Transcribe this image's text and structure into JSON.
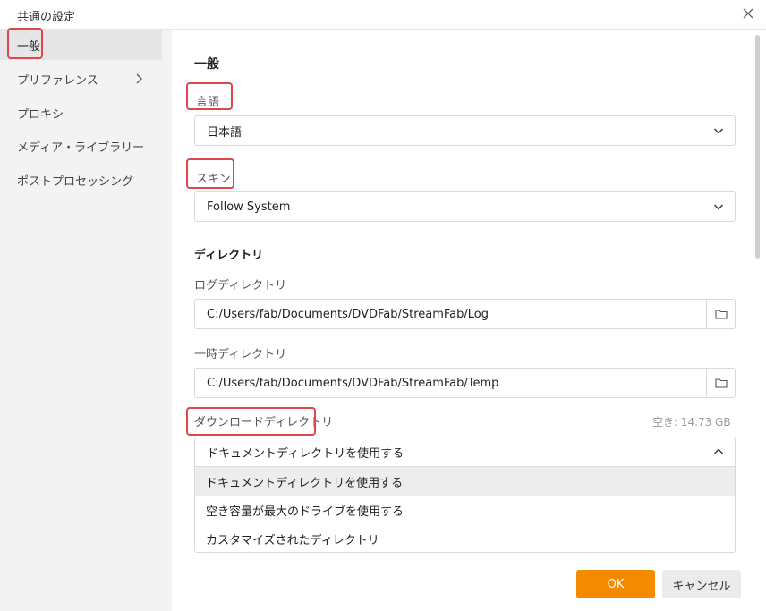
{
  "window": {
    "title": "共通の設定",
    "close_icon": "close-icon"
  },
  "sidebar": {
    "items": [
      {
        "label": "一般",
        "active": true
      },
      {
        "label": "プリファレンス",
        "has_submenu": true
      },
      {
        "label": "プロキシ"
      },
      {
        "label": "メディア・ライブラリー"
      },
      {
        "label": "ポストプロセッシング"
      }
    ]
  },
  "main": {
    "heading": "一般",
    "language": {
      "label": "言語",
      "value": "日本語"
    },
    "skin": {
      "label": "スキン",
      "value": "Follow System"
    },
    "directory": {
      "heading": "ディレクトリ",
      "log": {
        "label": "ログディレクトリ",
        "value": "C:/Users/fab/Documents/DVDFab/StreamFab/Log"
      },
      "temp": {
        "label": "一時ディレクトリ",
        "value": "C:/Users/fab/Documents/DVDFab/StreamFab/Temp"
      },
      "download": {
        "label": "ダウンロードディレクトリ",
        "free_space": "空き: 14.73 GB",
        "value": "ドキュメントディレクトリを使用する",
        "options": [
          "ドキュメントディレクトリを使用する",
          "空き容量が最大のドライブを使用する",
          "カスタマイズされたディレクトリ"
        ]
      }
    }
  },
  "footer": {
    "ok_label": "OK",
    "cancel_label": "キャンセル"
  },
  "colors": {
    "accent": "#f48a00",
    "highlight": "#e0464b",
    "sidebar_bg": "#f3f3f3"
  }
}
